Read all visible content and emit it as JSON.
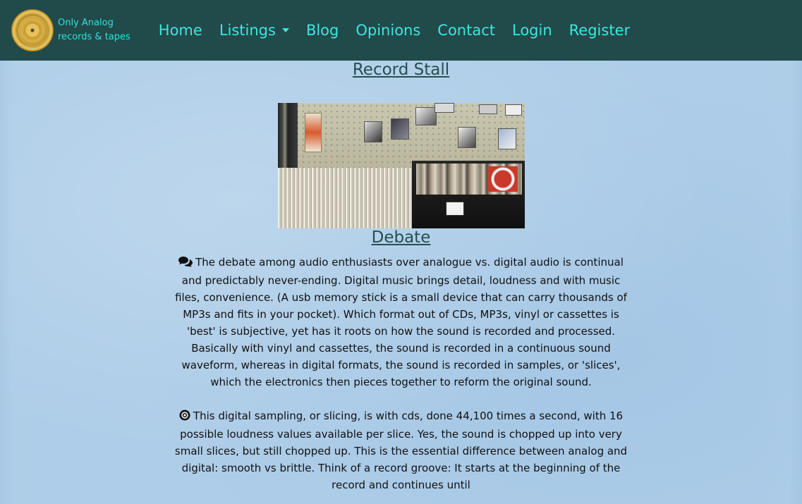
{
  "brand": {
    "line1": "Only Analog",
    "line2": "records & tapes"
  },
  "nav": {
    "items": [
      {
        "label": "Home"
      },
      {
        "label": "Listings"
      },
      {
        "label": "Blog"
      },
      {
        "label": "Opinions"
      },
      {
        "label": "Contact"
      },
      {
        "label": "Login"
      },
      {
        "label": "Register"
      }
    ]
  },
  "sections": {
    "record_stall_title": "Record Stall",
    "debate_title": "Debate",
    "paragraph1": "The debate among audio enthusiasts over analogue vs. digital audio is continual and predictably never-ending. Digital music brings detail, loudness and with music files, convenience. (A usb memory stick is a small device that can carry thousands of MP3s and fits in your pocket). Which format out of CDs, MP3s, vinyl or cassettes is 'best' is subjective, yet has it roots on how the sound is recorded and processed. Basically with vinyl and cassettes, the sound is recorded in a continuous sound waveform, whereas in digital formats, the sound is recorded in samples, or 'slices', which the electronics then pieces together to reform the original sound.",
    "paragraph2": "This digital sampling, or slicing, is with cds, done 44,100 times a second, with 16 possible loudness values available per slice. Yes, the sound is chopped up into very small slices, but still chopped up. This is the essential difference between analog and digital: smooth vs brittle. Think of a record groove: It starts at the beginning of the record and continues until"
  },
  "colors": {
    "navbar_bg": "#214a4a",
    "nav_link": "#3ee6dd",
    "heading": "#245050",
    "page_bg": "#aecde8"
  },
  "icons": {
    "paragraph1": "comments-icon",
    "paragraph2": "compact-disc-icon"
  }
}
